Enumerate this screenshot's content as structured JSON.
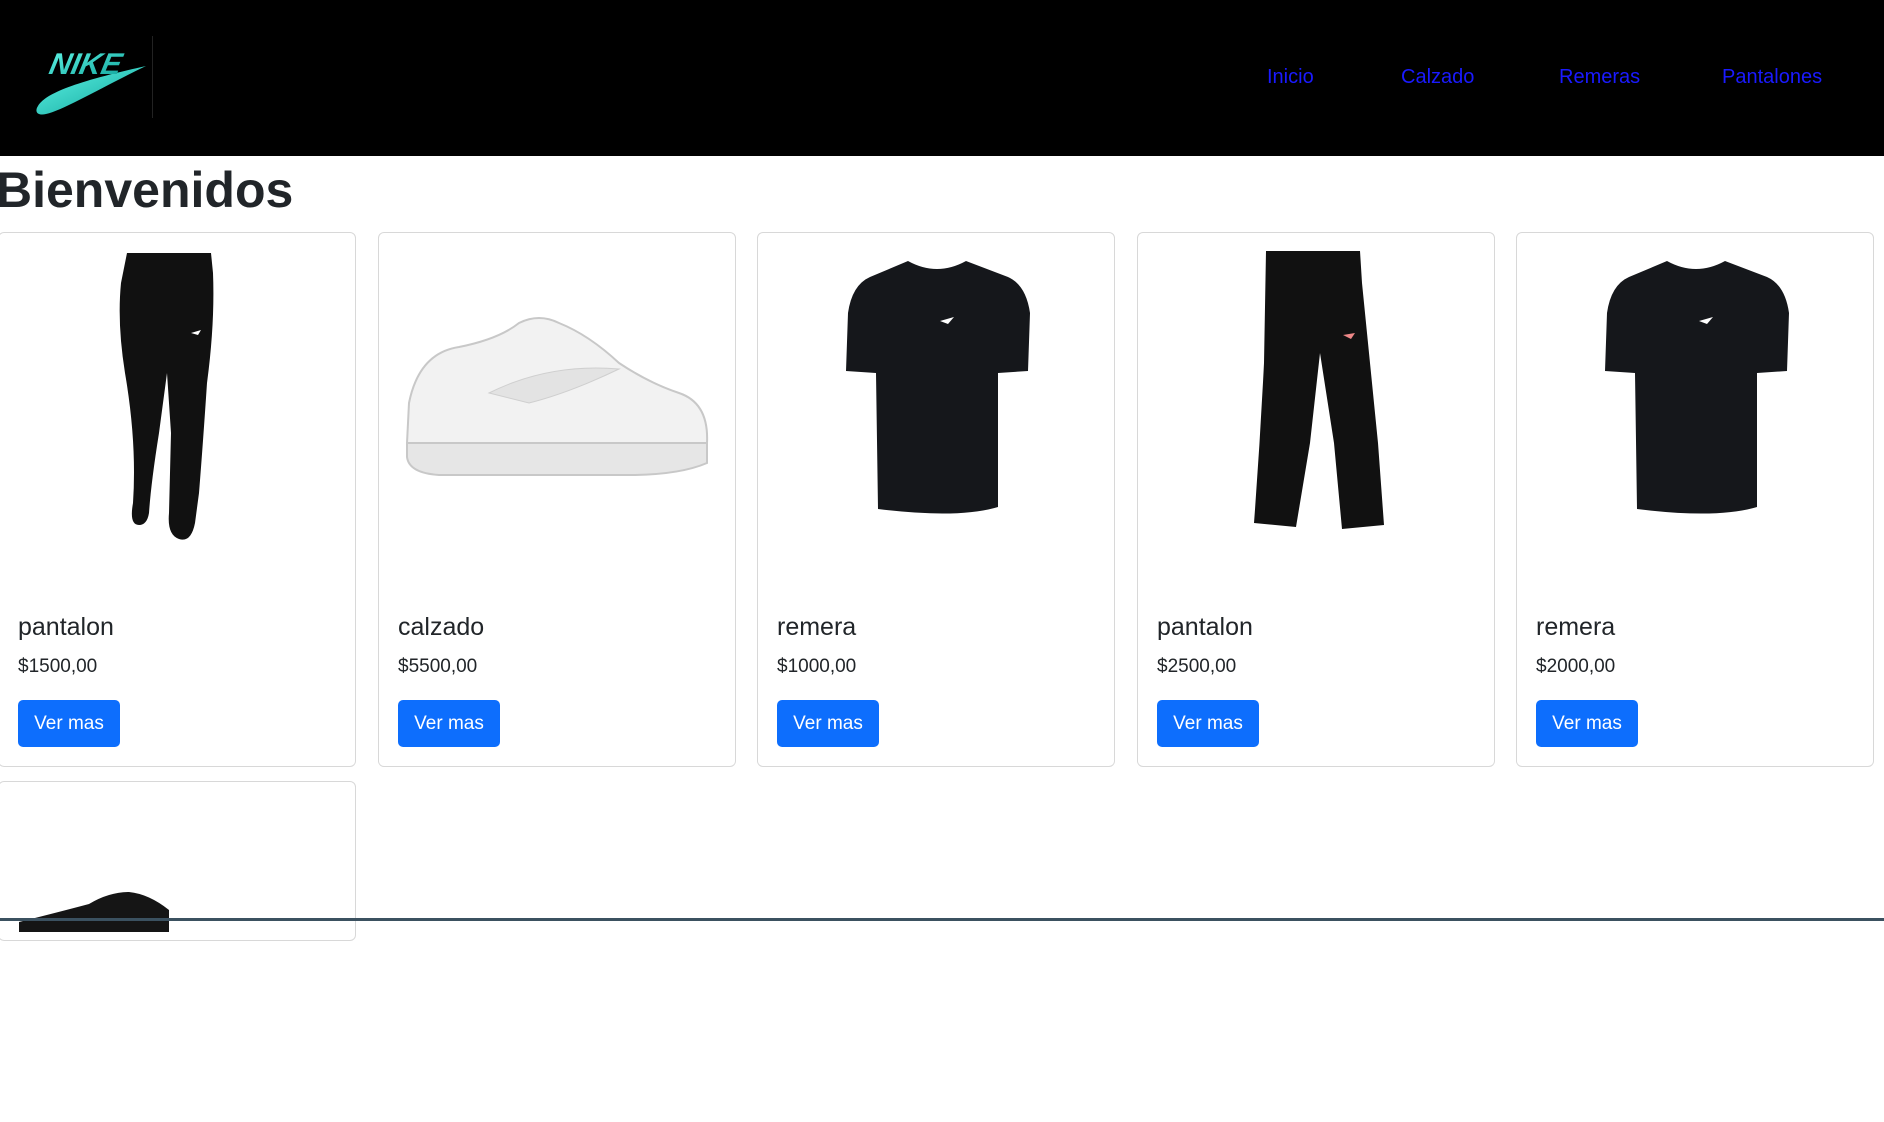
{
  "brand": {
    "logo_icon": "nike-logo-icon",
    "accent": "#1fd1c1"
  },
  "nav": {
    "items": [
      {
        "label": "Inicio"
      },
      {
        "label": "Calzado"
      },
      {
        "label": "Remeras"
      },
      {
        "label": "Pantalones"
      }
    ],
    "link_color": "#1a1aff"
  },
  "page": {
    "title": "Bienvenidos"
  },
  "products": [
    {
      "name": "pantalon",
      "price": "$1500,00",
      "button": "Ver mas",
      "image_icon": "pants-icon"
    },
    {
      "name": "calzado",
      "price": "$5500,00",
      "button": "Ver mas",
      "image_icon": "sneaker-icon"
    },
    {
      "name": "remera",
      "price": "$1000,00",
      "button": "Ver mas",
      "image_icon": "tshirt-icon"
    },
    {
      "name": "pantalon",
      "price": "$2500,00",
      "button": "Ver mas",
      "image_icon": "wide-pants-icon"
    },
    {
      "name": "remera",
      "price": "$2000,00",
      "button": "Ver mas",
      "image_icon": "tshirt-icon"
    },
    {
      "image_icon": "black-sneaker-icon"
    }
  ],
  "colors": {
    "button": "#0d6efd",
    "header_bg": "#000000"
  }
}
